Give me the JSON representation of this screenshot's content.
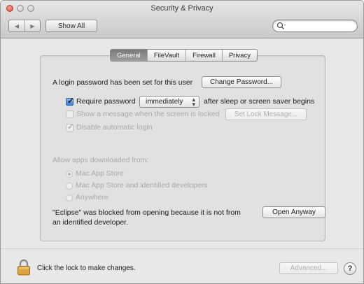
{
  "window": {
    "title": "Security & Privacy",
    "nav_back": "◀",
    "nav_forward": "▶",
    "show_all": "Show All",
    "search": {
      "value": "",
      "placeholder": ""
    }
  },
  "tabs": [
    {
      "label": "General",
      "active": true
    },
    {
      "label": "FileVault",
      "active": false
    },
    {
      "label": "Firewall",
      "active": false
    },
    {
      "label": "Privacy",
      "active": false
    }
  ],
  "general": {
    "login_password_text": "A login password has been set for this user",
    "change_password_button": "Change Password...",
    "require_password": {
      "label": "Require password",
      "checked": true
    },
    "require_password_delay": "immediately",
    "after_sleep_text": "after sleep or screen saver begins",
    "show_message": {
      "label": "Show a message when the screen is locked",
      "checked": false
    },
    "set_lock_message_button": "Set Lock Message...",
    "disable_auto_login": {
      "label": "Disable automatic login",
      "checked": true
    },
    "allow_apps_heading": "Allow apps downloaded from:",
    "allow_options": [
      {
        "label": "Mac App Store",
        "selected": true
      },
      {
        "label": "Mac App Store and identified developers",
        "selected": false
      },
      {
        "label": "Anywhere",
        "selected": false
      }
    ],
    "blocked_line1": "\"Eclipse\" was blocked from opening because it is not from",
    "blocked_line2": "an identified developer.",
    "open_anyway_button": "Open Anyway"
  },
  "footer": {
    "lock_text": "Click the lock to make changes.",
    "advanced_button": "Advanced...",
    "help_button": "?"
  },
  "colors": {
    "window_bg": "#e8e8e8",
    "panel_bg": "#e1e1e1",
    "checkbox_accent": "#3d7fd6",
    "lock_gold": "#d9a441"
  }
}
